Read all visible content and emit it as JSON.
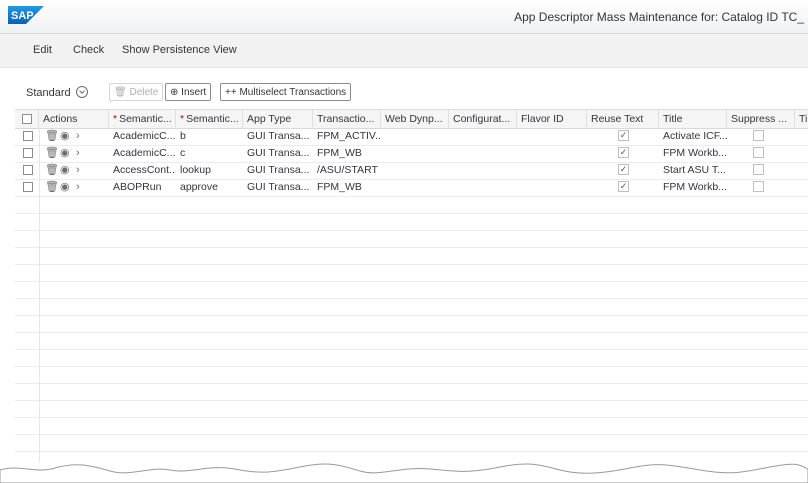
{
  "shell": {
    "logo_text": "SAP",
    "app_title": "App Descriptor Mass Maintenance for: Catalog ID TC_"
  },
  "menu": {
    "items": [
      "Edit",
      "Check",
      "Show Persistence View"
    ]
  },
  "toolbar": {
    "variant_label": "Standard",
    "delete_label": "Delete",
    "insert_label": "Insert",
    "multiselect_label": "++ Multiselect Transactions"
  },
  "table": {
    "columns": [
      "Actions",
      "Semantic...",
      "Semantic...",
      "App Type",
      "Transactio...",
      "Web Dynp...",
      "Configurat...",
      "Flavor ID",
      "Reuse Text",
      "Title",
      "Suppress ...",
      "Ti"
    ],
    "required_marker": "*",
    "rows": [
      {
        "semantic_object": "AcademicC...",
        "semantic_action": "b",
        "app_type": "GUI Transa...",
        "transaction": "FPM_ACTIV..",
        "reuse_text": true,
        "title": "Activate ICF...",
        "suppress": false
      },
      {
        "semantic_object": "AcademicC...",
        "semantic_action": "c",
        "app_type": "GUI Transa...",
        "transaction": "FPM_WB",
        "reuse_text": true,
        "title": "FPM Workb...",
        "suppress": false
      },
      {
        "semantic_object": "AccessCont...",
        "semantic_action": "lookup",
        "app_type": "GUI Transa...",
        "transaction": "/ASU/START",
        "reuse_text": true,
        "title": "Start ASU T...",
        "suppress": false
      },
      {
        "semantic_object": "ABOPRun",
        "semantic_action": "approve",
        "app_type": "GUI Transa...",
        "transaction": "FPM_WB",
        "reuse_text": true,
        "title": "FPM Workb...",
        "suppress": false
      }
    ],
    "icons": {
      "delete": "trash-icon",
      "detail": "eye-icon",
      "navigate": "chevron-right-icon"
    }
  },
  "colors": {
    "sap_blue": "#0a6ed1",
    "required": "#bb0000"
  }
}
